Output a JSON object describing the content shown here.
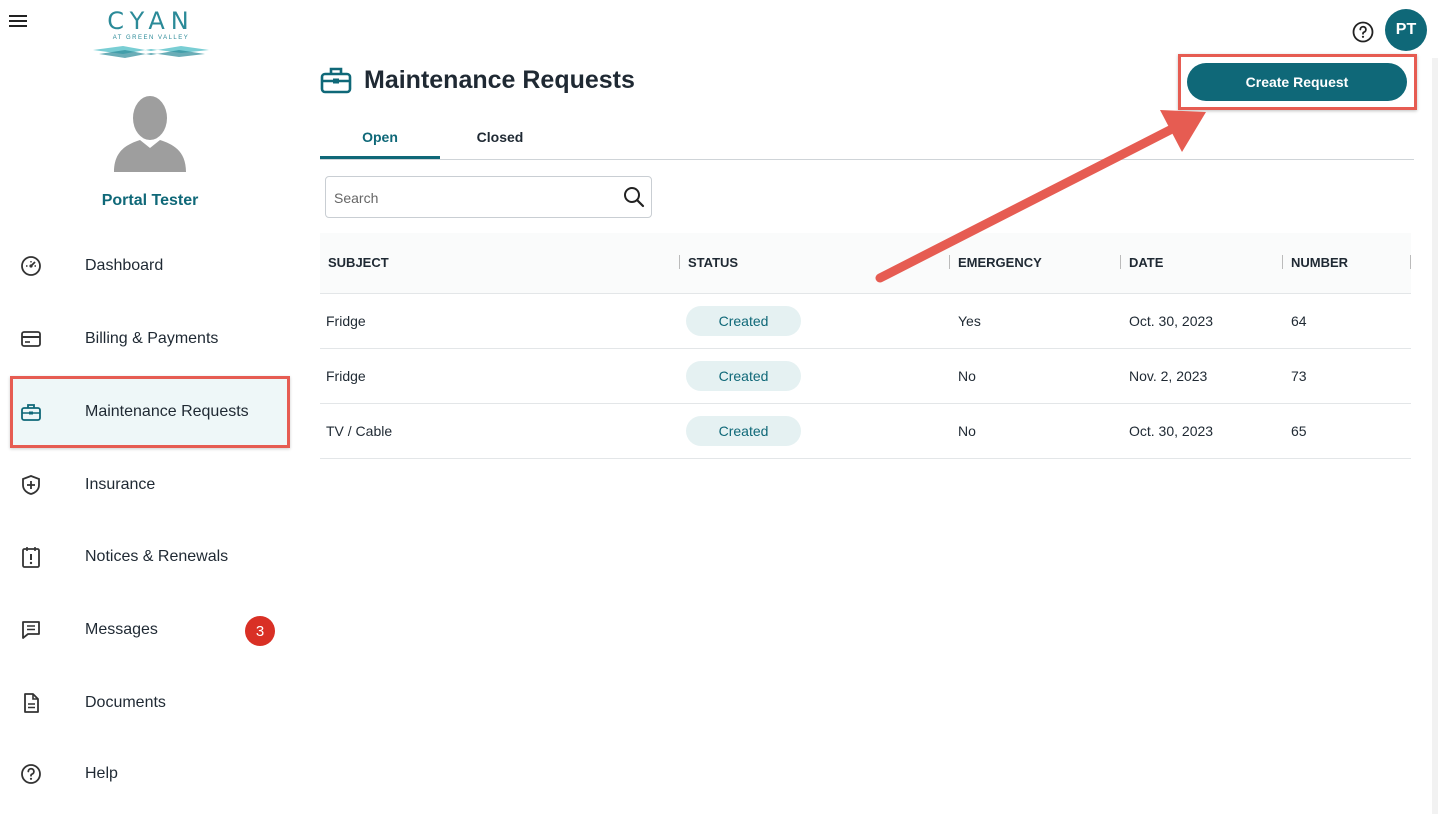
{
  "brand": {
    "name": "CYAN",
    "subtitle": "AT GREEN VALLEY"
  },
  "profile": {
    "name": "Portal Tester",
    "initials": "PT"
  },
  "sidebar": {
    "items": [
      {
        "label": "Dashboard",
        "icon": "dashboard-gauge-icon"
      },
      {
        "label": "Billing & Payments",
        "icon": "credit-card-icon"
      },
      {
        "label": "Maintenance Requests",
        "icon": "toolbox-icon",
        "active": true
      },
      {
        "label": "Insurance",
        "icon": "shield-plus-icon"
      },
      {
        "label": "Notices & Renewals",
        "icon": "clipboard-alert-icon"
      },
      {
        "label": "Messages",
        "icon": "message-icon",
        "badge": "3"
      },
      {
        "label": "Documents",
        "icon": "document-icon"
      },
      {
        "label": "Help",
        "icon": "help-circle-icon"
      }
    ]
  },
  "page": {
    "title": "Maintenance Requests",
    "create_label": "Create Request"
  },
  "tabs": [
    {
      "label": "Open",
      "active": true
    },
    {
      "label": "Closed"
    }
  ],
  "search": {
    "placeholder": "Search"
  },
  "table": {
    "headers": [
      "SUBJECT",
      "STATUS",
      "EMERGENCY",
      "DATE",
      "NUMBER"
    ],
    "rows": [
      {
        "subject": "Fridge",
        "status": "Created",
        "emergency": "Yes",
        "date": "Oct. 30, 2023",
        "number": "64"
      },
      {
        "subject": "Fridge",
        "status": "Created",
        "emergency": "No",
        "date": "Nov. 2, 2023",
        "number": "73"
      },
      {
        "subject": "TV / Cable",
        "status": "Created",
        "emergency": "No",
        "date": "Oct. 30, 2023",
        "number": "65"
      }
    ]
  },
  "colors": {
    "brand": "#0f6878",
    "highlight": "#e65c52",
    "badge": "#d93025"
  }
}
